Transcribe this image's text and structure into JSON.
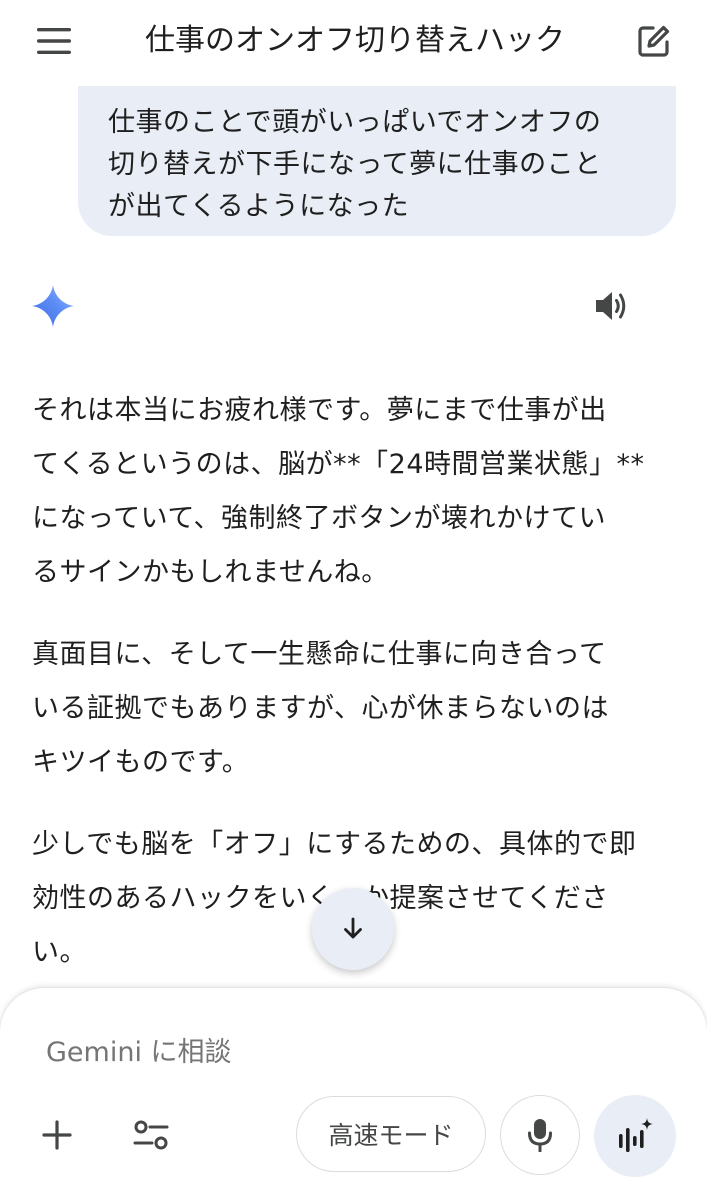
{
  "header": {
    "title": "仕事のオンオフ切り替えハック",
    "menu_icon": "hamburger-menu-icon",
    "edit_icon": "edit-icon"
  },
  "user_message": {
    "text": "仕事のことで頭がいっぱいでオンオフの\n切り替えが下手になって夢に仕事のこと\nが出てくるようになった"
  },
  "response": {
    "avatar_icon": "gemini-sparkle-icon",
    "speaker_icon": "speaker-icon",
    "paragraphs": [
      "それは本当にお疲れ様です。夢にまで仕事が出\nてくるというのは、脳が**「24時間営業状態」**\nになっていて、強制終了ボタンが壊れかけてい\nるサインかもしれませんね。",
      "真面目に、そして一生懸命に仕事に向き合って\nいる証拠でもありますが、心が休まらないのは\nキツイものです。",
      "少しでも脳を「オフ」にするための、具体的で即\n効性のあるハックをいくつか提案させてくださ\nい。"
    ]
  },
  "scroll_button": {
    "icon": "arrow-down-icon"
  },
  "composer": {
    "placeholder": "Gemini に相談",
    "mode_label": "高速モード",
    "add_icon": "plus-icon",
    "tools_icon": "tools-icon",
    "mic_icon": "microphone-icon",
    "live_icon": "live-waveform-icon"
  },
  "colors": {
    "bubble_bg": "#e9eef6",
    "text": "#1f1f1f",
    "placeholder": "#757575",
    "gemini_blue": "#4f7ef7"
  }
}
